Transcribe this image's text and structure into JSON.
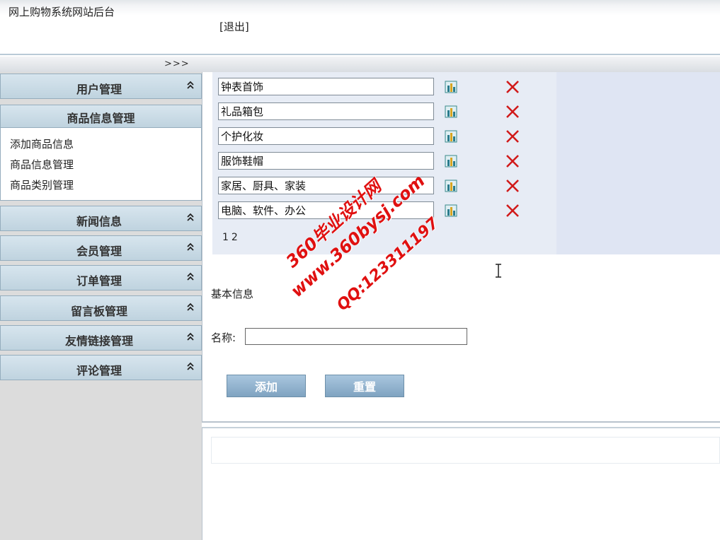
{
  "header": {
    "site_title": "网上购物系统网站后台",
    "logout": "[退出]",
    "toggle": ">>>"
  },
  "sidebar": {
    "menus": [
      {
        "label": "用户管理"
      },
      {
        "label": "新闻信息"
      },
      {
        "label": "会员管理"
      },
      {
        "label": "订单管理"
      },
      {
        "label": "留言板管理"
      },
      {
        "label": "友情链接管理"
      },
      {
        "label": "评论管理"
      }
    ],
    "open_menu": {
      "label": "商品信息管理",
      "items": [
        "添加商品信息",
        "商品信息管理",
        "商品类别管理"
      ]
    }
  },
  "categories": [
    "钟表首饰",
    "礼品箱包",
    "个护化妆",
    "服饰鞋帽",
    "家居、厨具、家装",
    "电脑、软件、办公"
  ],
  "pager": [
    "1",
    "2"
  ],
  "form": {
    "section_title": "基本信息",
    "name_label": "名称:",
    "name_value": "",
    "add_button": "添加",
    "reset_button": "重置"
  },
  "watermark": {
    "line1": "360毕业设计网",
    "line2": "www.360bysj.com",
    "line3": "QQ:123311197"
  },
  "colors": {
    "menu_bg": "#bfd3df",
    "button_bg": "#7fa3c1",
    "delete": "#d11a1a",
    "panel_bg": "#e7ecf5"
  }
}
